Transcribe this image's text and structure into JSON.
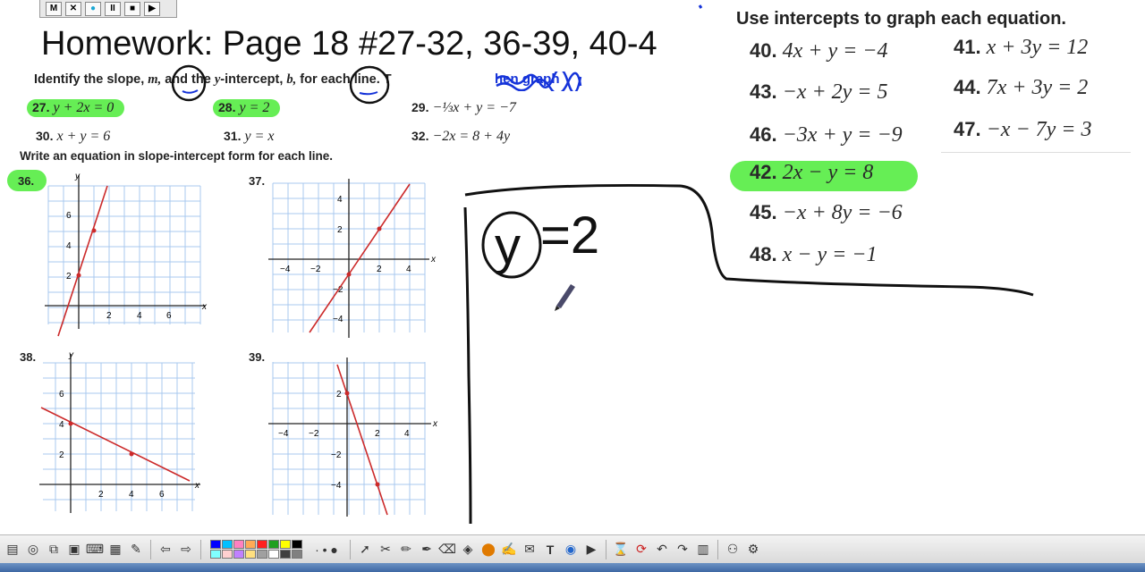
{
  "recorder": {
    "buttons": [
      "M",
      "✕",
      "●",
      "II",
      "■",
      "▶"
    ]
  },
  "title": "Homework: Page 18 #27-32, 36-39, 40-4",
  "instruction1": {
    "pre": "Identify the slope,",
    "m": "m,",
    "mid": "and the",
    "y": "y",
    "mid2": "-intercept,",
    "b": "b,",
    "post": "for each line. T",
    "scribble": "hen graph"
  },
  "problems_slope": [
    {
      "n": "27.",
      "eq": "y + 2x = 0",
      "hl": true
    },
    {
      "n": "28.",
      "eq": "y = 2",
      "hl": true
    },
    {
      "n": "29.",
      "eq": "−⅓x + y = −7",
      "hl": false
    },
    {
      "n": "30.",
      "eq": "x + y = 6",
      "hl": false
    },
    {
      "n": "31.",
      "eq": "y = x",
      "hl": false
    },
    {
      "n": "32.",
      "eq": "−2x = 8 + 4y",
      "hl": false
    }
  ],
  "instruction2": "Write an equation in slope-intercept form for each line.",
  "graphs": [
    {
      "n": "36.",
      "hl": true
    },
    {
      "n": "37.",
      "hl": false
    },
    {
      "n": "38.",
      "hl": false
    },
    {
      "n": "39.",
      "hl": false
    }
  ],
  "axis_labels": {
    "x": "x",
    "y": "y"
  },
  "ticks": {
    "g36x": [
      "2",
      "4",
      "6"
    ],
    "g36y": [
      "2",
      "4",
      "6"
    ],
    "g37x": [
      "−4",
      "−2",
      "2",
      "4"
    ],
    "g37y": [
      "4",
      "2",
      "−2",
      "−4"
    ],
    "g38x": [
      "2",
      "4",
      "6"
    ],
    "g38y": [
      "2",
      "4",
      "6"
    ],
    "g39x": [
      "−4",
      "−2",
      "2",
      "4"
    ],
    "g39y": [
      "2",
      "−2",
      "−4"
    ]
  },
  "right_title": "Use intercepts to graph each equation.",
  "intercept_problems": [
    {
      "n": "40.",
      "eq": "4x + y = −4"
    },
    {
      "n": "41.",
      "eq": "x + 3y = 12"
    },
    {
      "n": "43.",
      "eq": "−x + 2y = 5"
    },
    {
      "n": "44.",
      "eq": "7x + 3y = 2"
    },
    {
      "n": "46.",
      "eq": "−3x + y = −9"
    },
    {
      "n": "47.",
      "eq": "−x − 7y = 3"
    },
    {
      "n": "42.",
      "eq": "2x − y = 8",
      "hl": true
    },
    {
      "n": "45.",
      "eq": "−x + 8y = −6"
    },
    {
      "n": "48.",
      "eq": "x − y = −1"
    }
  ],
  "handwriting": {
    "eq_rest": "=2",
    "y": "y"
  },
  "colors": {
    "highlight": "#66ee55",
    "line": "#cc2a2a",
    "grid": "#a9c8ef",
    "ink": "#111111",
    "blue_ink": "#1533d9"
  },
  "toolbar_icons": [
    "select-icon",
    "pen-icon",
    "highlighter-icon",
    "eraser-icon",
    "fill-icon",
    "shape-icon",
    "line-icon",
    "text-icon",
    "undo-icon",
    "redo-icon",
    "page-icon"
  ],
  "palette": [
    "#0000ff",
    "#00c0ff",
    "#ff80c0",
    "#ffaa55",
    "#ff2020",
    "#20a020",
    "#ffff00",
    "#000000",
    "#80ffff",
    "#ffd0d0",
    "#c080ff",
    "#ffe080",
    "#a0a0a0",
    "#ffffff",
    "#404040",
    "#808080"
  ]
}
